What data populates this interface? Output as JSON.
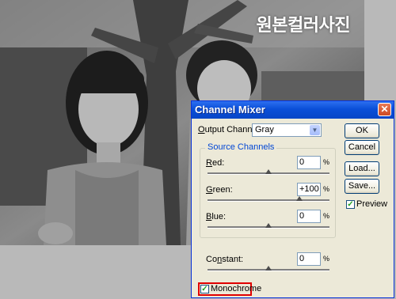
{
  "photo": {
    "caption": "원본컬러사진"
  },
  "dialog": {
    "title": "Channel Mixer",
    "close_symbol": "✕",
    "output_channel": {
      "label_prefix": "O",
      "label_rest": "utput Channel:",
      "value": "Gray"
    },
    "source_channels_label": "Source Channels",
    "channels": {
      "red": {
        "label_prefix": "R",
        "label_rest": "ed:",
        "value": "0",
        "unit": "%",
        "slider_fraction": 0.5
      },
      "green": {
        "label_prefix": "G",
        "label_rest": "reen:",
        "value": "+100",
        "unit": "%",
        "slider_fraction": 0.75
      },
      "blue": {
        "label_prefix": "B",
        "label_rest": "lue:",
        "value": "0",
        "unit": "%",
        "slider_fraction": 0.5
      }
    },
    "constant": {
      "label_prefix": "Co",
      "label_mid": "n",
      "label_rest": "stant:",
      "value": "0",
      "unit": "%",
      "slider_fraction": 0.5
    },
    "buttons": {
      "ok": "OK",
      "cancel": "Cancel",
      "load": "Load...",
      "save": "Save..."
    },
    "preview": {
      "label": "Preview",
      "checked": true
    },
    "monochrome": {
      "label": "Monochrome",
      "checked": true
    }
  }
}
